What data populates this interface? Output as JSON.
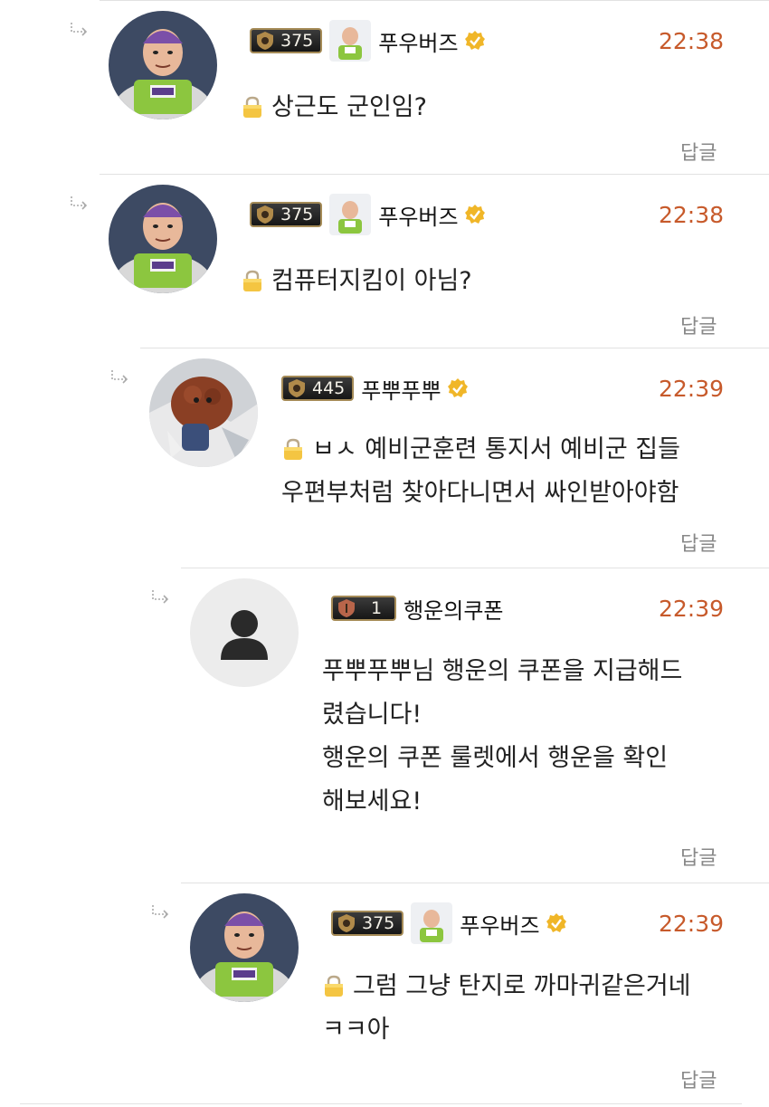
{
  "comments": [
    {
      "level": "375",
      "nickname": "푸우버즈",
      "time": "22:38",
      "lines": [
        "상근도 군인임?"
      ],
      "locked": true,
      "reply": "답글",
      "avatar": "buzz-avatar"
    },
    {
      "level": "375",
      "nickname": "푸우버즈",
      "time": "22:38",
      "lines": [
        "컴퓨터지킴이 아님?"
      ],
      "locked": true,
      "reply": "답글",
      "avatar": "buzz-avatar"
    },
    {
      "level": "445",
      "nickname": "푸뿌푸뿌",
      "time": "22:39",
      "lines": [
        "ㅂㅅ 예비군훈련 통지서 예비군 집들",
        "우편부처럼 찾아다니면서 싸인받아야함"
      ],
      "locked": true,
      "reply": "답글",
      "avatar": "dog-photo-avatar"
    },
    {
      "level": "1",
      "nickname": "행운의쿠폰",
      "time": "22:39",
      "lines": [
        "푸뿌푸뿌님 행운의 쿠폰을 지급해드",
        "렸습니다!",
        "행운의 쿠폰 룰렛에서 행운을 확인",
        "해보세요!"
      ],
      "locked": false,
      "reply": "답글",
      "avatar": "default-user-avatar"
    },
    {
      "level": "375",
      "nickname": "푸우버즈",
      "time": "22:39",
      "lines": [
        "그럼 그냥 탄지로 까마귀같은거네",
        "ㅋㅋ아"
      ],
      "locked": true,
      "reply": "답글",
      "avatar": "buzz-avatar"
    }
  ],
  "colors": {
    "time": "#c75a2b",
    "badge_border": "#a58b57",
    "verified": "#f0b628",
    "divider": "#e2e2e2",
    "reply": "#888888"
  }
}
